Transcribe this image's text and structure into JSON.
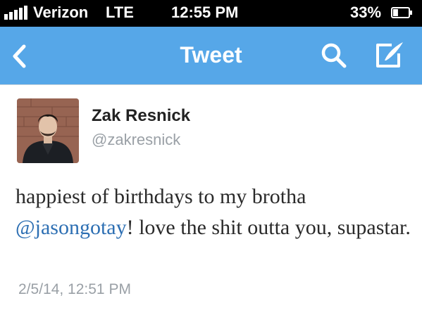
{
  "status_bar": {
    "carrier": "Verizon",
    "network": "LTE",
    "time": "12:55 PM",
    "battery": "33%",
    "signal_icon": "signal-bars-icon",
    "battery_icon": "battery-icon",
    "battery_level": 0.33
  },
  "nav": {
    "title": "Tweet",
    "back_icon": "back-chevron-icon",
    "search_icon": "search-icon",
    "compose_icon": "compose-icon"
  },
  "tweet": {
    "name": "Zak Resnick",
    "handle": "@zakresnick",
    "text_before": "happiest of birthdays to my brotha ",
    "mention": "@jasongotay",
    "text_after": "! love the shit outta you, supastar.",
    "timestamp": "2/5/14, 12:51 PM"
  },
  "colors": {
    "nav_background": "#56a7e8",
    "mention": "#2d6fb3",
    "muted": "#9aa0a6"
  }
}
